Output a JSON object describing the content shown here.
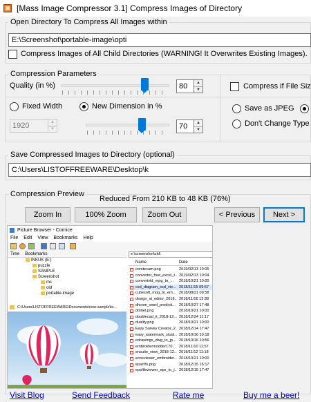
{
  "window": {
    "title": "[Mass Image Compressor 3.1] Compress Images of Directory"
  },
  "open_dir": {
    "legend": "Open Directory To Compress All Images within",
    "path": "E:\\Screenshot\\portable-image\\opti",
    "child_dirs_label": "Compress Images of All Child Directories (WARNING! It Overwrites Existing Images).",
    "child_dirs_checked": false
  },
  "params": {
    "legend": "Compression Parameters",
    "quality_label": "Quality (in %)",
    "quality_value": "80",
    "quality_level": 80,
    "fixed_width_label": "Fixed Width",
    "fixed_width_value": "1920",
    "new_dimension_label": "New Dimension in %",
    "dimension_value": "70",
    "dimension_level": 70,
    "compress_if_label": "Compress if File Size G",
    "save_jpeg_label": "Save as JPEG",
    "dont_change_label": "Don't Change Type (F"
  },
  "save_dir": {
    "legend": "Save Compressed Images to Directory (optional)",
    "path": "C:\\Users\\LISTOFFREEWARE\\Desktop\\k"
  },
  "preview": {
    "legend": "Compression Preview",
    "result": "Reduced From 210 KB to 48 KB (76%)",
    "zoom_in": "Zoom In",
    "zoom_100": "100% Zoom",
    "zoom_out": "Zoom Out",
    "previous": "< Previous",
    "next": "Next >"
  },
  "preview_image": {
    "window_title": "Picture Browser - Cornice",
    "menu": [
      "File",
      "Edit",
      "View",
      "Bookmarks",
      "Help"
    ],
    "tabs": [
      "Tree",
      "Bookmarks"
    ],
    "tree": [
      "INKUK (E:)",
      "puzzle",
      "SAMPLE",
      "Screenshot",
      "ms",
      "old",
      "portable-image"
    ],
    "inner_path": "C:\\Users\\LISTOFFREEWARE\\Documents\\new-sample\\le...",
    "path_field": "e:\\screenshot\\old\\",
    "list_headers": [
      "Name",
      "Date"
    ],
    "files": [
      {
        "name": "comtecam.png",
        "date": "2019/02/13 10:05"
      },
      {
        "name": "converter_free_excel_t...",
        "date": "2019/02/13 10:04"
      },
      {
        "name": "convertvid_mpg_to_...",
        "date": "2018/10/21 10:00"
      },
      {
        "name": "csd_diagram_xsd_vie...",
        "date": "2018/11/15 09:57"
      },
      {
        "name": "cubesoft_mog_to_em...",
        "date": "2018/08/21 09:58"
      },
      {
        "name": "design_ai_editor_2018...",
        "date": "2018/11/16 13:38"
      },
      {
        "name": "dhcom_word_predicti...",
        "date": "2018/10/27 17:48"
      },
      {
        "name": "dotnet.png",
        "date": "2018/10/21 10:00"
      },
      {
        "name": "doublecad_it_2018-12...",
        "date": "2018/12/24 11:17"
      },
      {
        "name": "duality.png",
        "date": "2018/10/21 10:00"
      },
      {
        "name": "Easy Survey Creator_2...",
        "date": "2018/12/14 17:47"
      },
      {
        "name": "easy_watermark_studi...",
        "date": "2018/10/16 10:18"
      },
      {
        "name": "edrawings_dwg_to_jp...",
        "date": "2018/10/16 10:56"
      },
      {
        "name": "embroidermodder170...",
        "date": "2018/11/10 11:57"
      },
      {
        "name": "ensuite_view_2018-12...",
        "date": "2018/11/12 11:18"
      },
      {
        "name": "ecosviewer_embroider...",
        "date": "2018/10/21 10:00"
      },
      {
        "name": "epsinfo.png",
        "date": "2018/12/15 16:17"
      },
      {
        "name": "epsfileviewer_eps_to_j...",
        "date": "2018/12/15 17:47"
      }
    ]
  },
  "footer": {
    "visit_blog": "Visit Blog",
    "send_feedback": "Send Feedback",
    "rate_me": "Rate me",
    "buy_beer": "Buy me a beer!"
  }
}
